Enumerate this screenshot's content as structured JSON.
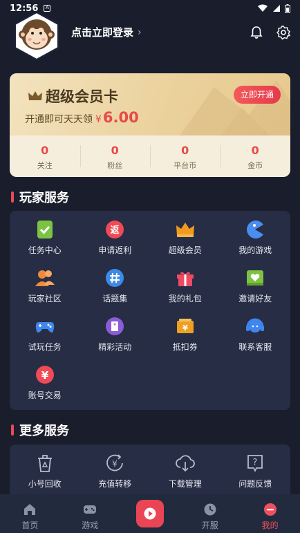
{
  "status_bar": {
    "time": "12:56",
    "notif": "A"
  },
  "header": {
    "login_text": "点击立即登录",
    "chevron": "›"
  },
  "vip": {
    "title": "超级会员卡",
    "subtitle": "开通即可天天领",
    "currency": "¥",
    "price": "6.00",
    "button": "立即开通",
    "stats": [
      {
        "value": "0",
        "label": "关注"
      },
      {
        "value": "0",
        "label": "粉丝"
      },
      {
        "value": "0",
        "label": "平台币"
      },
      {
        "value": "0",
        "label": "金币"
      }
    ]
  },
  "player_services": {
    "title": "玩家服务",
    "items": [
      {
        "label": "任务中心",
        "icon": "task-check-icon",
        "color": "#7dc242"
      },
      {
        "label": "申请返利",
        "icon": "rebate-icon",
        "color": "#ef4a55"
      },
      {
        "label": "超级会员",
        "icon": "crown-icon",
        "color": "#f39a1e"
      },
      {
        "label": "我的游戏",
        "icon": "pacman-icon",
        "color": "#4a8cf0"
      },
      {
        "label": "玩家社区",
        "icon": "community-icon",
        "color": "#f08a3a"
      },
      {
        "label": "话题集",
        "icon": "hashtag-icon",
        "color": "#3d8be8"
      },
      {
        "label": "我的礼包",
        "icon": "gift-icon",
        "color": "#ee4a63"
      },
      {
        "label": "邀请好友",
        "icon": "invite-icon",
        "color": "#7dc242"
      },
      {
        "label": "试玩任务",
        "icon": "gamepad-icon",
        "color": "#3f86ee"
      },
      {
        "label": "精彩活动",
        "icon": "activity-icon",
        "color": "#8b5bd8"
      },
      {
        "label": "抵扣券",
        "icon": "coupon-icon",
        "color": "#f0a020"
      },
      {
        "label": "联系客服",
        "icon": "support-icon",
        "color": "#3f86ee"
      },
      {
        "label": "账号交易",
        "icon": "account-trade-icon",
        "color": "#ef4a55"
      }
    ]
  },
  "more_services": {
    "title": "更多服务",
    "items": [
      {
        "label": "小号回收",
        "icon": "recycle-bin-icon"
      },
      {
        "label": "充值转移",
        "icon": "transfer-icon"
      },
      {
        "label": "下载管理",
        "icon": "download-cloud-icon"
      },
      {
        "label": "问题反馈",
        "icon": "feedback-icon"
      }
    ]
  },
  "tabbar": {
    "items": [
      {
        "label": "首页",
        "icon": "home-icon"
      },
      {
        "label": "游戏",
        "icon": "gamepad-icon"
      },
      {
        "label": "",
        "icon": "play-icon"
      },
      {
        "label": "开服",
        "icon": "clock-icon"
      },
      {
        "label": "我的",
        "icon": "profile-icon"
      }
    ],
    "active": "我的"
  },
  "colors": {
    "background": "#1a1e2c",
    "panel": "#262d44",
    "accent": "#ea4a58",
    "gold": "#ead09a"
  }
}
